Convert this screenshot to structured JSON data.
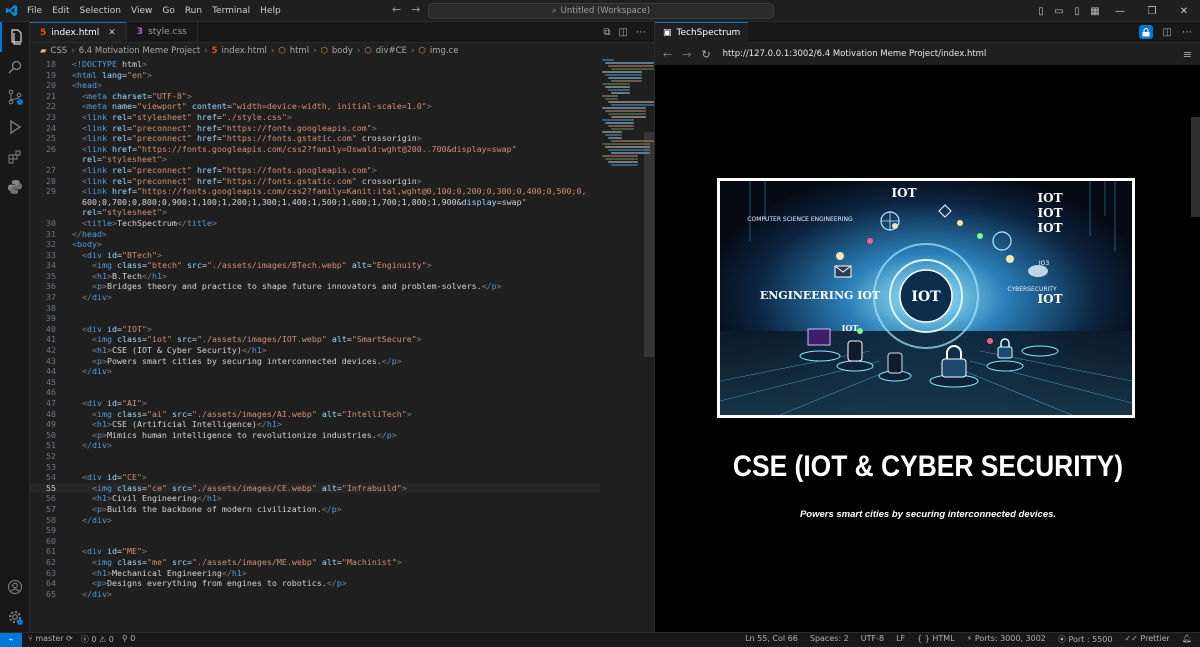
{
  "menu": [
    "File",
    "Edit",
    "Selection",
    "View",
    "Go",
    "Run",
    "Terminal",
    "Help"
  ],
  "search": {
    "label": "Untitled (Workspace)"
  },
  "editor": {
    "tabs": [
      {
        "label": "index.html",
        "icon": "html-file-icon",
        "active": true
      },
      {
        "label": "style.css",
        "icon": "css-file-icon",
        "active": false
      }
    ],
    "breadcrumb": [
      "CSS",
      "6.4 Motivation Meme Project",
      "index.html",
      "html",
      "body",
      "div#CE",
      "img.ce"
    ],
    "lines": [
      {
        "n": "18",
        "t": "<!DOCTYPE html>"
      },
      {
        "n": "19",
        "t": "<html lang=\"en\">"
      },
      {
        "n": "20",
        "t": "<head>"
      },
      {
        "n": "21",
        "t": "  <meta charset=\"UTF-8\">"
      },
      {
        "n": "22",
        "t": "  <meta name=\"viewport\" content=\"width=device-width, initial-scale=1.0\">"
      },
      {
        "n": "23",
        "t": "  <link rel=\"stylesheet\" href=\"./style.css\">"
      },
      {
        "n": "24",
        "t": "  <link rel=\"preconnect\" href=\"https://fonts.googleapis.com\">"
      },
      {
        "n": "25",
        "t": "  <link rel=\"preconnect\" href=\"https://fonts.gstatic.com\" crossorigin>"
      },
      {
        "n": "26",
        "t": "  <link href=\"https://fonts.googleapis.com/css2?family=Oswald:wght@200..700&display=swap\""
      },
      {
        "n": "",
        "t": "  rel=\"stylesheet\">"
      },
      {
        "n": "27",
        "t": "  <link rel=\"preconnect\" href=\"https://fonts.googleapis.com\">"
      },
      {
        "n": "28",
        "t": "  <link rel=\"preconnect\" href=\"https://fonts.gstatic.com\" crossorigin>"
      },
      {
        "n": "29",
        "t": "  <link href=\"https://fonts.googleapis.com/css2?family=Kanit:ital,wght@0,100;0,200;0,300;0,400;0,500;0,"
      },
      {
        "n": "",
        "t": "  600;0,700;0,800;0,900;1,100;1,200;1,300;1,400;1,500;1,600;1,700;1,800;1,900&display=swap\""
      },
      {
        "n": "",
        "t": "  rel=\"stylesheet\">"
      },
      {
        "n": "30",
        "t": "  <title>TechSpectrum</title>"
      },
      {
        "n": "31",
        "t": "</head>"
      },
      {
        "n": "32",
        "t": "<body>"
      },
      {
        "n": "33",
        "t": "  <div id=\"BTech\">"
      },
      {
        "n": "34",
        "t": "    <img class=\"btech\" src=\"./assets/images/BTech.webp\" alt=\"Enginuity\">"
      },
      {
        "n": "35",
        "t": "    <h1>B.Tech</h1>"
      },
      {
        "n": "36",
        "t": "    <p>Bridges theory and practice to shape future innovators and problem-solvers.</p>"
      },
      {
        "n": "37",
        "t": "  </div>"
      },
      {
        "n": "38",
        "t": ""
      },
      {
        "n": "39",
        "t": ""
      },
      {
        "n": "40",
        "t": "  <div id=\"IOT\">"
      },
      {
        "n": "41",
        "t": "    <img class=\"iot\" src=\"./assets/images/IOT.webp\" alt=\"SmartSecure\">"
      },
      {
        "n": "42",
        "t": "    <h1>CSE (IOT & Cyber Security)</h1>"
      },
      {
        "n": "43",
        "t": "    <p>Powers smart cities by securing interconnected devices.</p>"
      },
      {
        "n": "44",
        "t": "  </div>"
      },
      {
        "n": "45",
        "t": ""
      },
      {
        "n": "46",
        "t": ""
      },
      {
        "n": "47",
        "t": "  <div id=\"AI\">"
      },
      {
        "n": "48",
        "t": "    <img class=\"ai\" src=\"./assets/images/AI.webp\" alt=\"IntelliTech\">"
      },
      {
        "n": "49",
        "t": "    <h1>CSE (Artificial Intelligence)</h1>"
      },
      {
        "n": "50",
        "t": "    <p>Mimics human intelligence to revolutionize industries.</p>"
      },
      {
        "n": "51",
        "t": "  </div>"
      },
      {
        "n": "52",
        "t": ""
      },
      {
        "n": "53",
        "t": ""
      },
      {
        "n": "54",
        "t": "  <div id=\"CE\">"
      },
      {
        "n": "55",
        "t": "    <img class=\"ce\" src=\"./assets/images/CE.webp\" alt=\"Infrabuild\">"
      },
      {
        "n": "56",
        "t": "    <h1>Civil Engineering</h1>"
      },
      {
        "n": "57",
        "t": "    <p>Builds the backbone of modern civilization.</p>"
      },
      {
        "n": "58",
        "t": "  </div>"
      },
      {
        "n": "59",
        "t": ""
      },
      {
        "n": "60",
        "t": ""
      },
      {
        "n": "61",
        "t": "  <div id=\"ME\">"
      },
      {
        "n": "62",
        "t": "    <img class=\"me\" src=\"./assets/images/ME.webp\" alt=\"Machinist\">"
      },
      {
        "n": "63",
        "t": "    <h1>Mechanical Engineering</h1>"
      },
      {
        "n": "64",
        "t": "    <p>Designs everything from engines to robotics.</p>"
      },
      {
        "n": "65",
        "t": "  </div>"
      }
    ],
    "current_line": "55"
  },
  "browser": {
    "tab_label": "TechSpectrum",
    "url": "http://127.0.0.1:3002/6.4 Motivation Meme Project/index.html",
    "heading": "CSE (IOT & CYBER SECURITY)",
    "paragraph": "Powers smart cities by securing interconnected devices.",
    "image_labels": {
      "iot_top": "IOT",
      "iot_stack": [
        "IOT",
        "IOT",
        "IOT"
      ],
      "cse": "COMPUTER SCIENCE ENGINEERING",
      "iot_center": "IOT",
      "engineering_iot": "ENGINEERING IOT",
      "cybersecurity": "CYBERSECURITY",
      "iot_right": "IOT",
      "iot_small": "IOT",
      "io3": "IO3"
    }
  },
  "statusbar": {
    "branch": "master",
    "errors": "0",
    "warnings": "0",
    "info": "0",
    "position": "Ln 55, Col 66",
    "spaces": "Spaces: 2",
    "encoding": "UTF-8",
    "eol": "LF",
    "language": "HTML",
    "ports": "Ports: 3000, 3002",
    "port": "Port : 5500",
    "formatter": "Prettier"
  },
  "colors": {
    "accent": "#0078d4",
    "tag": "#569cd6",
    "attr": "#9cdcfe",
    "string": "#ce9178",
    "text": "#d4d4d4"
  }
}
